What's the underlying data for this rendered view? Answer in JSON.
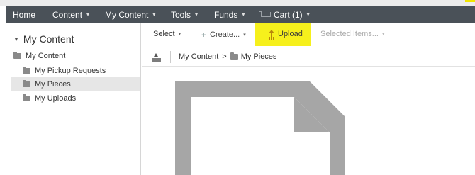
{
  "nav": {
    "items": [
      {
        "label": "Home",
        "dropdown": false
      },
      {
        "label": "Content",
        "dropdown": true
      },
      {
        "label": "My Content",
        "dropdown": true
      },
      {
        "label": "Tools",
        "dropdown": true
      },
      {
        "label": "Funds",
        "dropdown": true
      },
      {
        "label": "Cart (1)",
        "dropdown": true,
        "icon": "cart-icon"
      }
    ]
  },
  "sidebar": {
    "title": "My Content",
    "tree": [
      {
        "label": "My Content",
        "icon": "folder-icon"
      },
      {
        "label": "My Pickup Requests",
        "icon": "folder-icon"
      },
      {
        "label": "My Pieces",
        "icon": "folder-icon",
        "selected": true
      },
      {
        "label": "My Uploads",
        "icon": "folder-icon"
      }
    ]
  },
  "toolbar": {
    "select_label": "Select",
    "create_label": "Create...",
    "upload_label": "Upload",
    "selected_items_label": "Selected Items...",
    "highlight_color": "#f6f01c"
  },
  "breadcrumb": {
    "root": "My Content",
    "separator": ">",
    "current": "My Pieces"
  },
  "colors": {
    "nav_background": "#4a5158",
    "document_placeholder": "#a6a6a6"
  }
}
